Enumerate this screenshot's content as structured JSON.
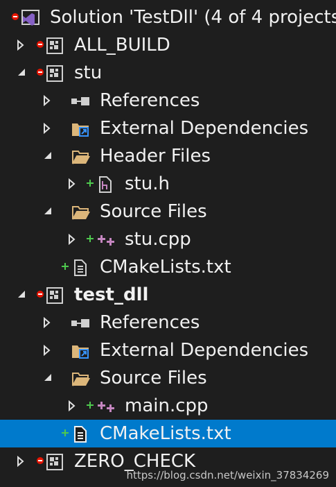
{
  "solution": {
    "title": "Solution 'TestDll' (4 of 4 projects)"
  },
  "projects": {
    "all_build": {
      "label": "ALL_BUILD"
    },
    "stu": {
      "label": "stu",
      "references": "References",
      "external": "External Dependencies",
      "header_files": "Header Files",
      "stu_h": "stu.h",
      "source_files": "Source Files",
      "stu_cpp": "stu.cpp",
      "cmakelists": "CMakeLists.txt"
    },
    "test_dll": {
      "label": "test_dll",
      "references": "References",
      "external": "External Dependencies",
      "source_files": "Source Files",
      "main_cpp": "main.cpp",
      "cmakelists": "CMakeLists.txt"
    },
    "zero_check": {
      "label": "ZERO_CHECK"
    }
  },
  "watermark": "https://blog.csdn.net/weixin_37834269",
  "colors": {
    "background": "#1e1e1e",
    "selection": "#007acc",
    "text": "#f1f1f1",
    "state_minus": "#e51400",
    "state_plus": "#4ec94e",
    "folder": "#dcb67a",
    "project_icon": "#d0d0d0",
    "vs_logo": "#8661c5"
  }
}
